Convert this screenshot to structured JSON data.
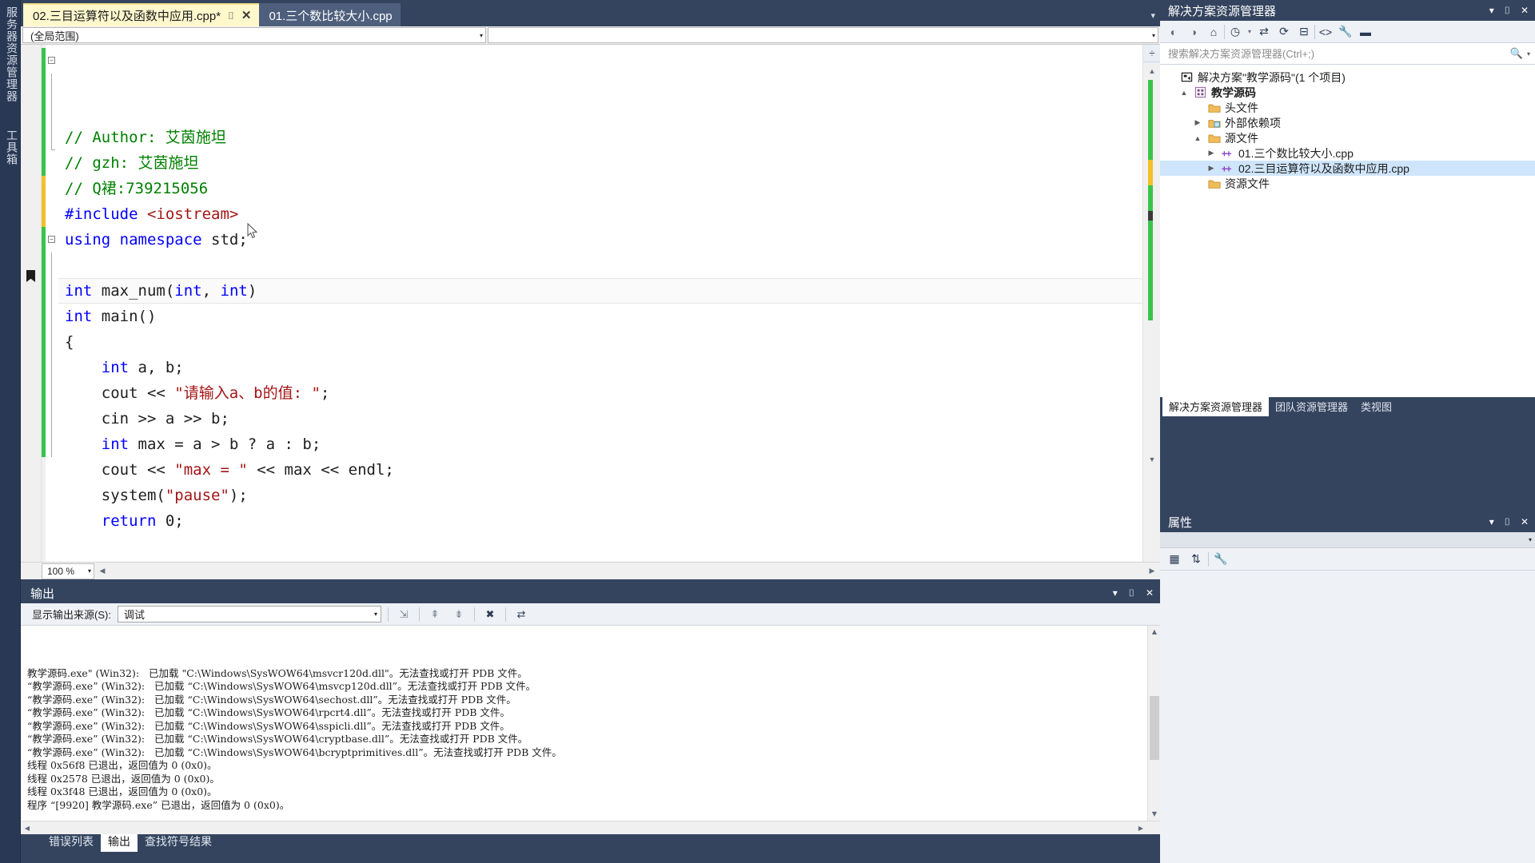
{
  "left_dock": {
    "tabs": [
      {
        "label": "服务器资源管理器",
        "name": "server-explorer"
      },
      {
        "label": "工具箱",
        "name": "toolbox"
      }
    ]
  },
  "editor": {
    "tabs": [
      {
        "label": "02.三目运算符以及函数中应用.cpp*",
        "active": true,
        "pin": "⌷",
        "close": "✕"
      },
      {
        "label": "01.三个数比较大小.cpp",
        "active": false
      }
    ],
    "tabstrip_overflow": "▾",
    "scope_dropdown": "(全局范围)",
    "member_dropdown": "",
    "dropdown_arrow": "▾",
    "zoom_level": "100 %",
    "zoom_arrow": "▾",
    "split_icon": "÷",
    "code_lines": [
      {
        "fold": "minus",
        "change": "green",
        "segments": [
          {
            "t": "// Author: 艾茵施坦",
            "c": "cm"
          }
        ]
      },
      {
        "fold": "line",
        "change": "green",
        "segments": [
          {
            "t": "// gzh: 艾茵施坦",
            "c": "cm"
          }
        ]
      },
      {
        "fold": "line",
        "change": "green",
        "segments": [
          {
            "t": "// Q裙:739215056",
            "c": "cm"
          }
        ]
      },
      {
        "fold": "end",
        "change": "green",
        "segments": [
          {
            "t": "#include ",
            "c": "pp"
          },
          {
            "t": "<iostream>",
            "c": "inc"
          }
        ]
      },
      {
        "fold": "none",
        "change": "green",
        "segments": [
          {
            "t": "using namespace ",
            "c": "kw"
          },
          {
            "t": "std;",
            "c": "pl"
          }
        ]
      },
      {
        "fold": "none",
        "change": "yellow",
        "segments": [
          {
            "t": "",
            "c": "pl"
          }
        ]
      },
      {
        "fold": "none",
        "change": "yellow",
        "boxed": true,
        "segments": [
          {
            "t": "int",
            "c": "kw"
          },
          {
            "t": " max_num(",
            "c": "pl"
          },
          {
            "t": "int",
            "c": "kw"
          },
          {
            "t": ", ",
            "c": "pl"
          },
          {
            "t": "int",
            "c": "kw"
          },
          {
            "t": ")",
            "c": "pl"
          }
        ]
      },
      {
        "fold": "minus",
        "change": "green",
        "segments": [
          {
            "t": "int",
            "c": "kw"
          },
          {
            "t": " main()",
            "c": "pl"
          }
        ]
      },
      {
        "fold": "line",
        "change": "green",
        "segments": [
          {
            "t": "{",
            "c": "pl"
          }
        ]
      },
      {
        "fold": "line",
        "change": "green",
        "segments": [
          {
            "t": "    ",
            "c": "pl"
          },
          {
            "t": "int",
            "c": "kw"
          },
          {
            "t": " a, b;",
            "c": "pl"
          }
        ]
      },
      {
        "fold": "line",
        "change": "green",
        "segments": [
          {
            "t": "    cout << ",
            "c": "pl"
          },
          {
            "t": "\"请输入a、b的值: \"",
            "c": "str"
          },
          {
            "t": ";",
            "c": "pl"
          }
        ]
      },
      {
        "fold": "line",
        "change": "green",
        "segments": [
          {
            "t": "    cin >> a >> b;",
            "c": "pl"
          }
        ]
      },
      {
        "fold": "line",
        "change": "green",
        "segments": [
          {
            "t": "    ",
            "c": "pl"
          },
          {
            "t": "int",
            "c": "kw"
          },
          {
            "t": " max = a > b ? a : b;",
            "c": "pl"
          }
        ]
      },
      {
        "fold": "line",
        "change": "green",
        "segments": [
          {
            "t": "    cout << ",
            "c": "pl"
          },
          {
            "t": "\"max = \"",
            "c": "str"
          },
          {
            "t": " << max << endl;",
            "c": "pl"
          }
        ]
      },
      {
        "fold": "line",
        "change": "green",
        "segments": [
          {
            "t": "    system(",
            "c": "pl"
          },
          {
            "t": "\"pause\"",
            "c": "str"
          },
          {
            "t": ");",
            "c": "pl"
          }
        ]
      },
      {
        "fold": "line",
        "change": "green",
        "segments": [
          {
            "t": "    ",
            "c": "pl"
          },
          {
            "t": "return",
            "c": "kw"
          },
          {
            "t": " 0;",
            "c": "pl"
          }
        ]
      }
    ]
  },
  "output": {
    "title": "输出",
    "source_label": "显示输出来源(S):",
    "source_value": "调试",
    "source_arrow": "▾",
    "lines": [
      "教学源码.exe\" (Win32):   已加载 \"C:\\Windows\\SysWOW64\\msvcr120d.dll\"。无法查找或打开 PDB 文件。",
      "“教学源码.exe” (Win32):   已加载 “C:\\Windows\\SysWOW64\\msvcp120d.dll”。无法查找或打开 PDB 文件。",
      "“教学源码.exe” (Win32):   已加载 “C:\\Windows\\SysWOW64\\sechost.dll”。无法查找或打开 PDB 文件。",
      "“教学源码.exe” (Win32):   已加载 “C:\\Windows\\SysWOW64\\rpcrt4.dll”。无法查找或打开 PDB 文件。",
      "“教学源码.exe” (Win32):   已加载 “C:\\Windows\\SysWOW64\\sspicli.dll”。无法查找或打开 PDB 文件。",
      "“教学源码.exe” (Win32):   已加载 “C:\\Windows\\SysWOW64\\cryptbase.dll”。无法查找或打开 PDB 文件。",
      "“教学源码.exe” (Win32):   已加载 “C:\\Windows\\SysWOW64\\bcryptprimitives.dll”。无法查找或打开 PDB 文件。",
      "线程 0x56f8 已退出，返回值为 0 (0x0)。",
      "线程 0x2578 已退出，返回值为 0 (0x0)。",
      "线程 0x3f48 已退出，返回值为 0 (0x0)。",
      "程序 “[9920] 教学源码.exe” 已退出，返回值为 0 (0x0)。"
    ],
    "window_controls": {
      "dropdown": "▾",
      "pin": "⌷",
      "close": "✕"
    }
  },
  "bottom_tabs": [
    {
      "label": "错误列表",
      "active": false
    },
    {
      "label": "输出",
      "active": true
    },
    {
      "label": "查找符号结果",
      "active": false
    }
  ],
  "solution_explorer": {
    "title": "解决方案资源管理器",
    "window_controls": {
      "dropdown": "▾",
      "pin": "⌷",
      "close": "✕"
    },
    "search_placeholder": "搜索解决方案资源管理器(Ctrl+;)",
    "search_value": "",
    "tree": [
      {
        "indent": 0,
        "twisty": "",
        "icon": "solution-icon",
        "label": "解决方案\"教学源码\"(1 个项目)",
        "bold": false,
        "selected": false
      },
      {
        "indent": 1,
        "twisty": "▲",
        "icon": "project-icon",
        "label": "教学源码",
        "bold": true,
        "selected": false
      },
      {
        "indent": 2,
        "twisty": "",
        "icon": "folder-icon",
        "label": "头文件",
        "bold": false,
        "selected": false
      },
      {
        "indent": 2,
        "twisty": "▶",
        "icon": "ext-dep-icon",
        "label": "外部依赖项",
        "bold": false,
        "selected": false
      },
      {
        "indent": 2,
        "twisty": "▲",
        "icon": "folder-icon",
        "label": "源文件",
        "bold": false,
        "selected": false
      },
      {
        "indent": 3,
        "twisty": "▶",
        "icon": "cpp-file-icon",
        "label": "01.三个数比较大小.cpp",
        "bold": false,
        "selected": false
      },
      {
        "indent": 3,
        "twisty": "▶",
        "icon": "cpp-file-icon",
        "label": "02.三目运算符以及函数中应用.cpp",
        "bold": false,
        "selected": true
      },
      {
        "indent": 2,
        "twisty": "",
        "icon": "folder-icon",
        "label": "资源文件",
        "bold": false,
        "selected": false
      }
    ],
    "tabs": [
      {
        "label": "解决方案资源管理器",
        "active": true
      },
      {
        "label": "团队资源管理器",
        "active": false
      },
      {
        "label": "类视图",
        "active": false
      }
    ]
  },
  "properties": {
    "title": "属性",
    "window_controls": {
      "dropdown": "▾",
      "pin": "⌷",
      "close": "✕"
    },
    "combo_arrow": "▾"
  },
  "colors": {
    "chrome": "#34445f",
    "chrome_dark": "#293955",
    "active_tab": "#fff8cd",
    "selection": "#cfe5fb",
    "comment": "#008000",
    "keyword": "#0000ff",
    "string": "#a31515",
    "change_green": "#39c44b",
    "change_yellow": "#f2c029"
  }
}
